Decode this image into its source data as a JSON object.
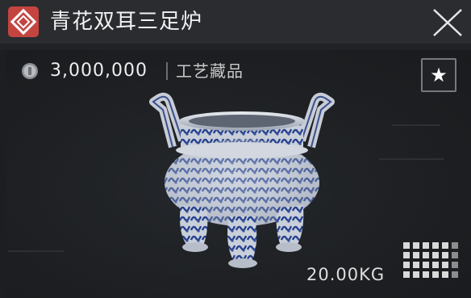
{
  "item": {
    "title": "青花双耳三足炉",
    "price": "3,000,000",
    "category": "工艺藏品",
    "weight": "20.00KG"
  },
  "icons": {
    "badge": "diamond-icon",
    "currency": "coin-icon",
    "close": "close-icon",
    "favorite": "star-icon",
    "size": "grid-size-icon"
  },
  "colors": {
    "accent": "#c44540",
    "header_bg": "#2a2c30",
    "panel_bg": "#1c1e21",
    "text": "#f2f2f2"
  },
  "favorite_glyph": "★"
}
